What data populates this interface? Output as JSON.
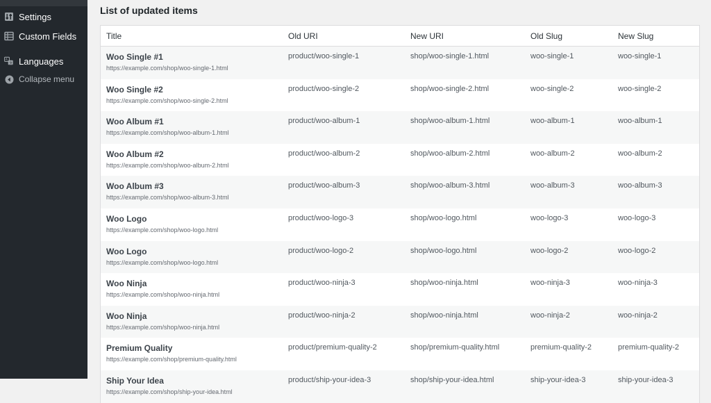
{
  "sidebar": {
    "items": [
      {
        "label": "Settings",
        "icon": "settings-icon"
      },
      {
        "label": "Custom Fields",
        "icon": "custom-fields-icon"
      },
      {
        "label": "Languages",
        "icon": "languages-icon"
      },
      {
        "label": "Collapse menu",
        "icon": "collapse-icon"
      }
    ]
  },
  "main": {
    "title": "List of updated items",
    "columns": [
      "Title",
      "Old URI",
      "New URI",
      "Old Slug",
      "New Slug"
    ],
    "rows": [
      {
        "title": "Woo Single #1",
        "url": "https://example.com/shop/woo-single-1.html",
        "old_uri": "product/woo-single-1",
        "new_uri": "shop/woo-single-1.html",
        "old_slug": "woo-single-1",
        "new_slug": "woo-single-1"
      },
      {
        "title": "Woo Single #2",
        "url": "https://example.com/shop/woo-single-2.html",
        "old_uri": "product/woo-single-2",
        "new_uri": "shop/woo-single-2.html",
        "old_slug": "woo-single-2",
        "new_slug": "woo-single-2"
      },
      {
        "title": "Woo Album #1",
        "url": "https://example.com/shop/woo-album-1.html",
        "old_uri": "product/woo-album-1",
        "new_uri": "shop/woo-album-1.html",
        "old_slug": "woo-album-1",
        "new_slug": "woo-album-1"
      },
      {
        "title": "Woo Album #2",
        "url": "https://example.com/shop/woo-album-2.html",
        "old_uri": "product/woo-album-2",
        "new_uri": "shop/woo-album-2.html",
        "old_slug": "woo-album-2",
        "new_slug": "woo-album-2"
      },
      {
        "title": "Woo Album #3",
        "url": "https://example.com/shop/woo-album-3.html",
        "old_uri": "product/woo-album-3",
        "new_uri": "shop/woo-album-3.html",
        "old_slug": "woo-album-3",
        "new_slug": "woo-album-3"
      },
      {
        "title": "Woo Logo",
        "url": "https://example.com/shop/woo-logo.html",
        "old_uri": "product/woo-logo-3",
        "new_uri": "shop/woo-logo.html",
        "old_slug": "woo-logo-3",
        "new_slug": "woo-logo-3"
      },
      {
        "title": "Woo Logo",
        "url": "https://example.com/shop/woo-logo.html",
        "old_uri": "product/woo-logo-2",
        "new_uri": "shop/woo-logo.html",
        "old_slug": "woo-logo-2",
        "new_slug": "woo-logo-2"
      },
      {
        "title": "Woo Ninja",
        "url": "https://example.com/shop/woo-ninja.html",
        "old_uri": "product/woo-ninja-3",
        "new_uri": "shop/woo-ninja.html",
        "old_slug": "woo-ninja-3",
        "new_slug": "woo-ninja-3"
      },
      {
        "title": "Woo Ninja",
        "url": "https://example.com/shop/woo-ninja.html",
        "old_uri": "product/woo-ninja-2",
        "new_uri": "shop/woo-ninja.html",
        "old_slug": "woo-ninja-2",
        "new_slug": "woo-ninja-2"
      },
      {
        "title": "Premium Quality",
        "url": "https://example.com/shop/premium-quality.html",
        "old_uri": "product/premium-quality-2",
        "new_uri": "shop/premium-quality.html",
        "old_slug": "premium-quality-2",
        "new_slug": "premium-quality-2"
      },
      {
        "title": "Ship Your Idea",
        "url": "https://example.com/shop/ship-your-idea.html",
        "old_uri": "product/ship-your-idea-3",
        "new_uri": "shop/ship-your-idea.html",
        "old_slug": "ship-your-idea-3",
        "new_slug": "ship-your-idea-3"
      }
    ]
  },
  "colors": {
    "sidebar_bg": "#23282d",
    "page_bg": "#f1f1f1",
    "row_alt": "#f6f7f7",
    "border": "#dcdcde"
  }
}
